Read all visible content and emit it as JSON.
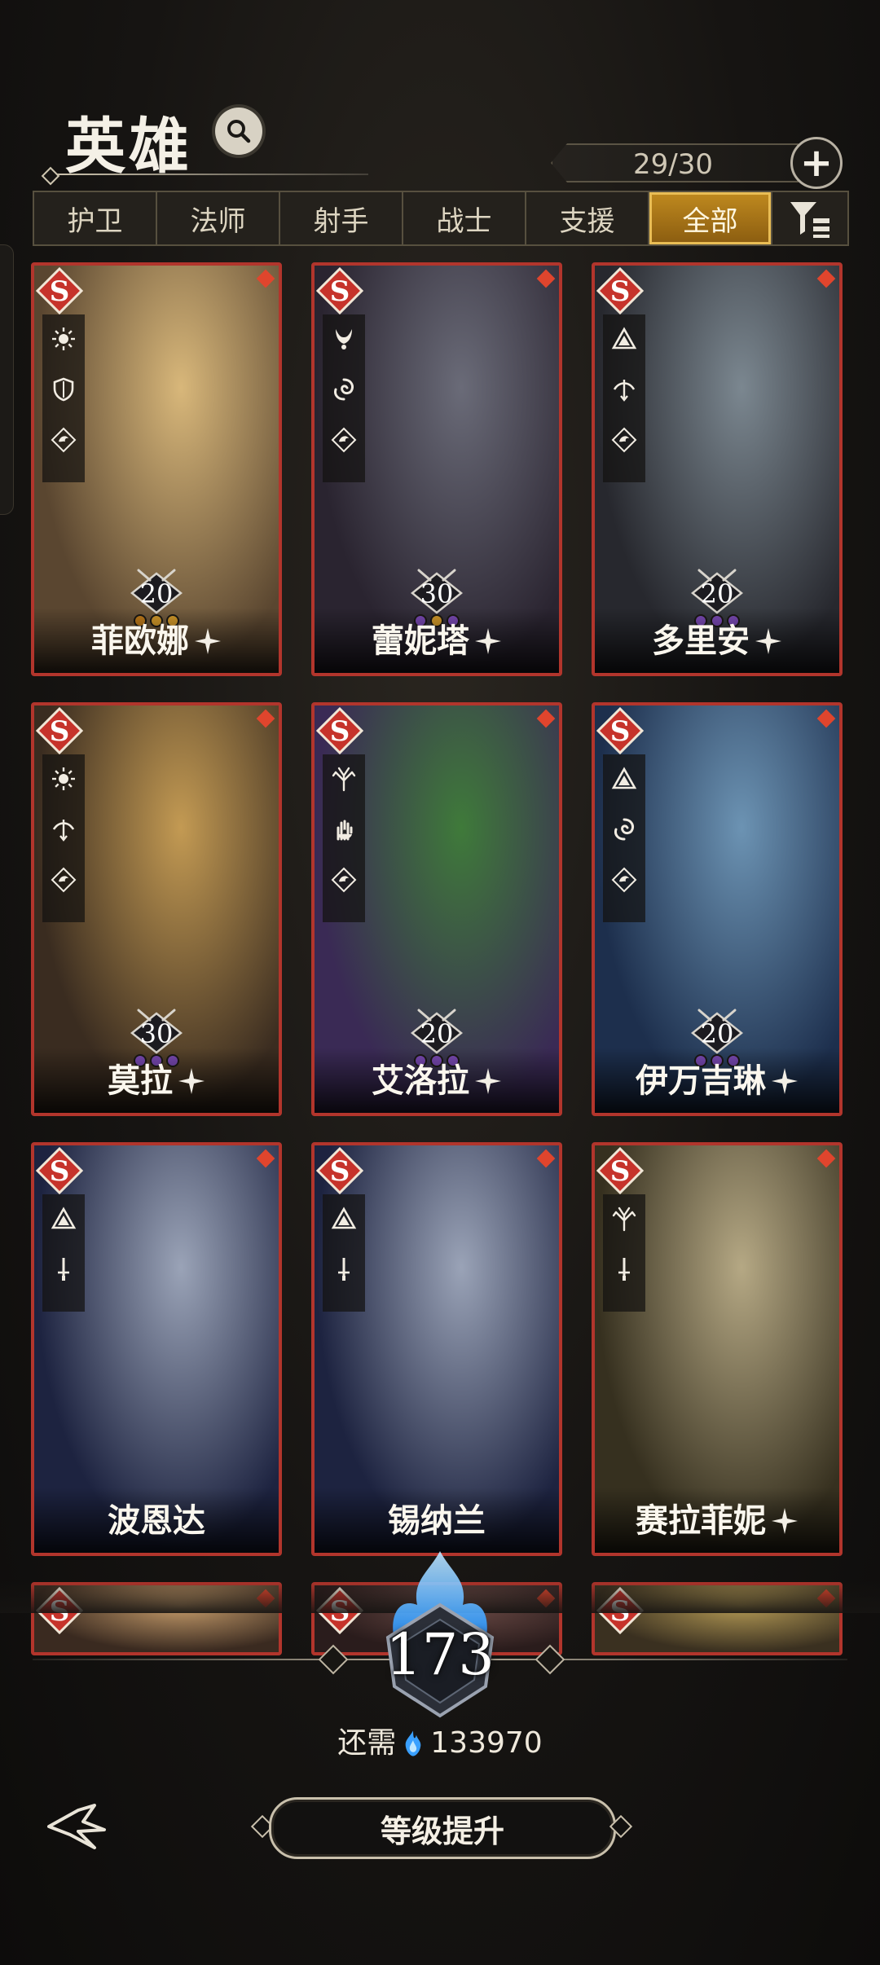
{
  "header": {
    "title": "英雄",
    "count": "29/30"
  },
  "tabs": [
    {
      "label": "护卫"
    },
    {
      "label": "法师"
    },
    {
      "label": "射手"
    },
    {
      "label": "战士"
    },
    {
      "label": "支援"
    },
    {
      "label": "全部",
      "active": true
    }
  ],
  "heroes": [
    {
      "name": "菲欧娜",
      "level": "20",
      "sparkle": true,
      "art_colors": [
        "#d8b77a",
        "#5a4630"
      ],
      "classes": [
        "sun-icon",
        "shield-icon",
        "dragon-icon"
      ],
      "dots": [
        "#c07b1a",
        "#d49a2a",
        "#d49a2a"
      ]
    },
    {
      "name": "蕾妮塔",
      "level": "30",
      "sparkle": true,
      "art_colors": [
        "#6a6b78",
        "#2a2430"
      ],
      "classes": [
        "horns-icon",
        "swirl-icon",
        "dragon-icon"
      ],
      "dots": [
        "#7b4ab5",
        "#d49a2a",
        "#7b4ab5"
      ]
    },
    {
      "name": "多里安",
      "level": "20",
      "sparkle": true,
      "art_colors": [
        "#7b8790",
        "#27282e"
      ],
      "classes": [
        "triangle-icon",
        "bow-icon",
        "dragon-icon"
      ],
      "dots": [
        "#7b4ab5",
        "#7b4ab5",
        "#7b4ab5"
      ]
    },
    {
      "name": "莫拉",
      "level": "30",
      "sparkle": true,
      "art_colors": [
        "#c39a53",
        "#3a2c20"
      ],
      "classes": [
        "sun-icon",
        "bow-icon",
        "dragon-icon"
      ],
      "dots": [
        "#7b4ab5",
        "#7b4ab5",
        "#7b4ab5"
      ]
    },
    {
      "name": "艾洛拉",
      "level": "20",
      "sparkle": true,
      "art_colors": [
        "#3f7a3a",
        "#3a2a55"
      ],
      "classes": [
        "tree-icon",
        "hand-icon",
        "dragon-icon"
      ],
      "dots": [
        "#7b4ab5",
        "#7b4ab5",
        "#7b4ab5"
      ]
    },
    {
      "name": "伊万吉琳",
      "level": "20",
      "sparkle": true,
      "art_colors": [
        "#6c93b3",
        "#1d2f4d"
      ],
      "classes": [
        "triangle-icon",
        "swirl-icon",
        "dragon-icon"
      ],
      "dots": [
        "#7b4ab5",
        "#7b4ab5",
        "#7b4ab5"
      ]
    },
    {
      "name": "波恩达",
      "level": "",
      "sparkle": false,
      "art_colors": [
        "#9aa3b7",
        "#1d2340"
      ],
      "classes": [
        "triangle-icon",
        "sword-icon"
      ],
      "dots": []
    },
    {
      "name": "锡纳兰",
      "level": "",
      "sparkle": false,
      "art_colors": [
        "#9aa3b7",
        "#1d2340"
      ],
      "classes": [
        "triangle-icon",
        "sword-icon"
      ],
      "dots": []
    },
    {
      "name": "赛拉菲妮",
      "level": "",
      "sparkle": true,
      "art_colors": [
        "#b5a884",
        "#36301f"
      ],
      "classes": [
        "tree-icon",
        "sword-icon"
      ],
      "dots": []
    },
    {
      "name": "",
      "level": "",
      "sparkle": false,
      "art_colors": [
        "#c49b6a",
        "#3a2a20"
      ],
      "classes": [],
      "dots": []
    },
    {
      "name": "",
      "level": "",
      "sparkle": false,
      "art_colors": [
        "#6c4b46",
        "#2a1c1c"
      ],
      "classes": [],
      "dots": []
    },
    {
      "name": "",
      "level": "",
      "sparkle": false,
      "art_colors": [
        "#b49a55",
        "#3a3020"
      ],
      "classes": [],
      "dots": []
    }
  ],
  "footer": {
    "soul_count": "173",
    "need_label": "还需",
    "need_amount": "133970",
    "upgrade_label": "等级提升"
  },
  "colors": {
    "card_border": "#b2352c",
    "tab_active": "#c08a1f",
    "flame": "#3aa0ff"
  }
}
